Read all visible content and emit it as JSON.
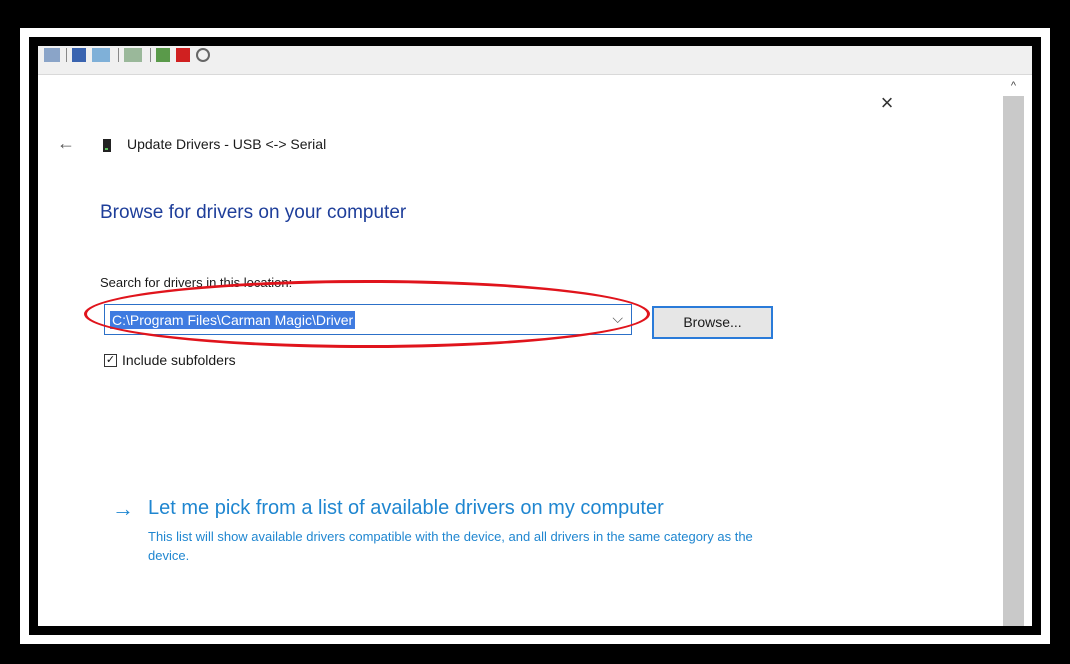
{
  "window": {
    "close_icon": "×",
    "back_icon": "←",
    "header_title": "Update Drivers - USB <-> Serial"
  },
  "scrollbar": {
    "up_icon": "^"
  },
  "main": {
    "heading": "Browse for drivers on your computer",
    "search_label": "Search for drivers in this location:",
    "path_value": "C:\\Program Files\\Carman Magic\\Driver",
    "dropdown_icon": "⌵",
    "browse_label": "Browse...",
    "include_subfolders": {
      "checked_mark": "✓",
      "label": "Include subfolders"
    },
    "pick_link": {
      "arrow_icon": "→",
      "title": "Let me pick from a list of available drivers on my computer",
      "description": "This list will show available drivers compatible with the device, and all drivers in the same category as the device."
    }
  },
  "colors": {
    "accent_blue": "#1f86d0",
    "heading_blue": "#1e3e9a",
    "selection_blue": "#3f7be0",
    "highlight_red": "#e0141c"
  }
}
